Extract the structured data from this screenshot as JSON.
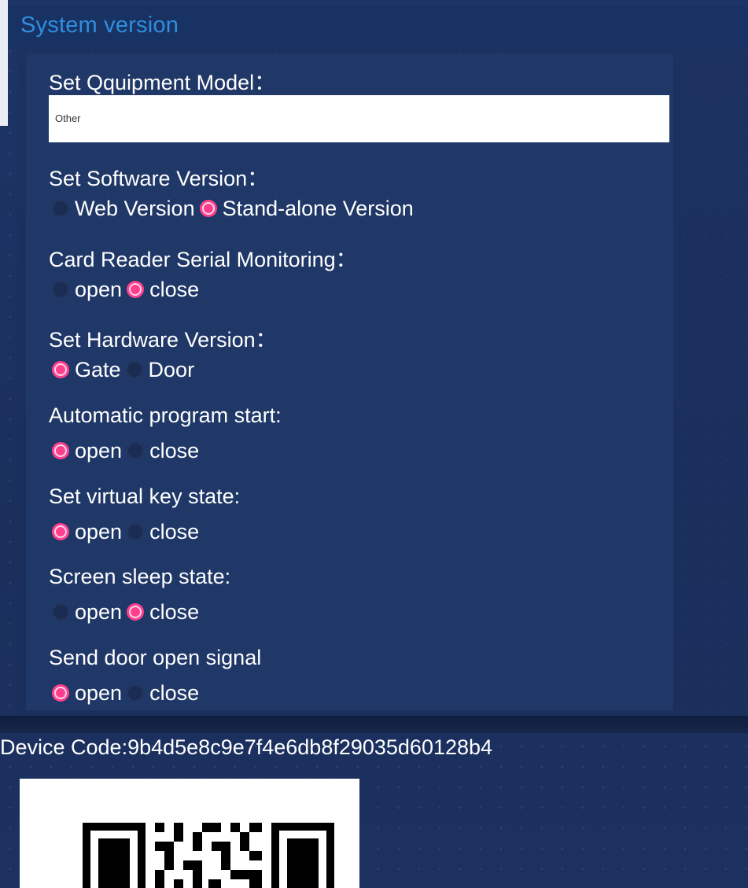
{
  "header": {
    "title": "System version"
  },
  "settings": {
    "model": {
      "label": "Set Qquipment Model：",
      "value": "Other"
    },
    "software": {
      "label": "Set Software Version：",
      "options": [
        "Web Version",
        "Stand-alone Version"
      ],
      "selected": "Stand-alone Version"
    },
    "card_reader": {
      "label": "Card Reader Serial Monitoring：",
      "options": [
        "open",
        "close"
      ],
      "selected": "close"
    },
    "hardware": {
      "label": "Set Hardware Version：",
      "options": [
        "Gate",
        "Door"
      ],
      "selected": "Gate"
    },
    "auto_start": {
      "label": "Automatic program start:",
      "options": [
        "open",
        "close"
      ],
      "selected": "open"
    },
    "virtual_key": {
      "label": "Set virtual key state:",
      "options": [
        "open",
        "close"
      ],
      "selected": "open"
    },
    "screen_sleep": {
      "label": "Screen sleep state:",
      "options": [
        "open",
        "close"
      ],
      "selected": "close"
    },
    "door_signal": {
      "label": "Send door open signal",
      "options": [
        "open",
        "close"
      ],
      "selected": "open"
    }
  },
  "device": {
    "code_text": "Device Code:9b4d5e8c9e7f4e6db8f29035d60128b4"
  },
  "icons": {
    "qr": "qr-code-icon"
  },
  "colors": {
    "accent": "#ff3f8e",
    "title": "#2f8ee0",
    "background": "#1a2a4f"
  }
}
